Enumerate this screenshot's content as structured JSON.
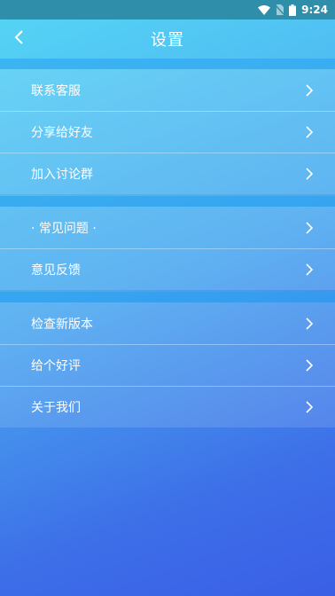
{
  "status_bar": {
    "time": "9:24",
    "icons": [
      "wifi-icon",
      "no-sim-icon",
      "battery-icon"
    ]
  },
  "header": {
    "title": "设置",
    "back_icon": "chevron-left-icon"
  },
  "groups": [
    {
      "items": [
        {
          "label": "联系客服"
        },
        {
          "label": "分享给好友"
        },
        {
          "label": "加入讨论群"
        }
      ]
    },
    {
      "items": [
        {
          "label": "· 常见问题 ·"
        },
        {
          "label": "意见反馈"
        }
      ]
    },
    {
      "items": [
        {
          "label": "检查新版本"
        },
        {
          "label": "给个好评"
        },
        {
          "label": "关于我们"
        }
      ]
    }
  ],
  "colors": {
    "status_bar": "#2f8fab",
    "gradient_top": "#55d6f5",
    "gradient_bottom": "#3a5fe6",
    "text": "#ffffff"
  }
}
